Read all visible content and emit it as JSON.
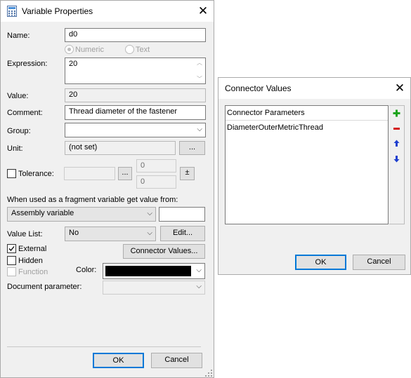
{
  "variable_properties": {
    "title": "Variable Properties",
    "close": "✕",
    "name_label": "Name:",
    "name_value": "d0",
    "numeric_label": "Numeric",
    "text_label": "Text",
    "expression_label": "Expression:",
    "expression_value": "20",
    "value_label": "Value:",
    "value_value": "20",
    "comment_label": "Comment:",
    "comment_value": "Thread diameter of the fastener",
    "group_label": "Group:",
    "group_value": "",
    "unit_label": "Unit:",
    "unit_value": "(not set)",
    "unit_button": "...",
    "tolerance_label": "Tolerance:",
    "tolerance_button": "...",
    "tolerance_upper": "0",
    "tolerance_lower": "0",
    "plusminus": "±",
    "fragment_label": "When used as a fragment variable get value from:",
    "fragment_select": "Assembly variable",
    "fragment_text": "",
    "value_list_label": "Value List:",
    "value_list_select": "No",
    "edit_button": "Edit...",
    "external_label": "External",
    "external_checked": true,
    "hidden_label": "Hidden",
    "function_label": "Function",
    "connector_values_button": "Connector Values...",
    "color_label": "Color:",
    "color_value": "#000000",
    "document_parameter_label": "Document parameter:",
    "document_parameter_value": "",
    "ok_button": "OK",
    "cancel_button": "Cancel"
  },
  "connector_values": {
    "title": "Connector Values",
    "close": "✕",
    "column_header": "Connector Parameters",
    "rows": [
      "DiameterOuterMetricThread"
    ],
    "add_icon_color": "#1aa31a",
    "remove_icon_color": "#d41c1c",
    "move_icon_color": "#1e3fcf",
    "ok_button": "OK",
    "cancel_button": "Cancel"
  }
}
